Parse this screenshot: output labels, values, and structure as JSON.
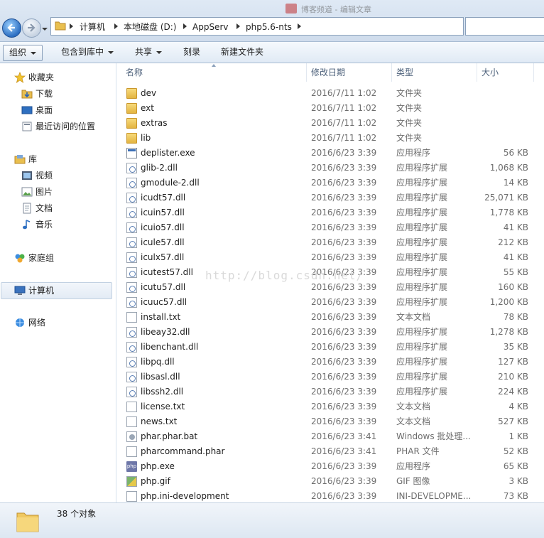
{
  "address": {
    "breadcrumbs": [
      "计算机",
      "本地磁盘 (D:)",
      "AppServ",
      "php5.6-nts"
    ],
    "background_tab_title": "博客频道 - 编辑文章"
  },
  "toolbar": {
    "organize": "组织",
    "include_in_library": "包含到库中",
    "share": "共享",
    "burn": "刻录",
    "new_folder": "新建文件夹"
  },
  "nav": {
    "favorites": "收藏夹",
    "downloads": "下载",
    "desktop": "桌面",
    "recent": "最近访问的位置",
    "libraries": "库",
    "videos": "视频",
    "pictures": "图片",
    "documents": "文档",
    "music": "音乐",
    "homegroup": "家庭组",
    "computer": "计算机",
    "network": "网络"
  },
  "columns": {
    "name": "名称",
    "date": "修改日期",
    "type": "类型",
    "size": "大小"
  },
  "files": [
    {
      "name": "dev",
      "date": "2016/7/11 1:02",
      "type": "文件夹",
      "size": "",
      "icon": "folder"
    },
    {
      "name": "ext",
      "date": "2016/7/11 1:02",
      "type": "文件夹",
      "size": "",
      "icon": "folder"
    },
    {
      "name": "extras",
      "date": "2016/7/11 1:02",
      "type": "文件夹",
      "size": "",
      "icon": "folder"
    },
    {
      "name": "lib",
      "date": "2016/7/11 1:02",
      "type": "文件夹",
      "size": "",
      "icon": "folder"
    },
    {
      "name": "deplister.exe",
      "date": "2016/6/23 3:39",
      "type": "应用程序",
      "size": "56 KB",
      "icon": "exe"
    },
    {
      "name": "glib-2.dll",
      "date": "2016/6/23 3:39",
      "type": "应用程序扩展",
      "size": "1,068 KB",
      "icon": "dll"
    },
    {
      "name": "gmodule-2.dll",
      "date": "2016/6/23 3:39",
      "type": "应用程序扩展",
      "size": "14 KB",
      "icon": "dll"
    },
    {
      "name": "icudt57.dll",
      "date": "2016/6/23 3:39",
      "type": "应用程序扩展",
      "size": "25,071 KB",
      "icon": "dll"
    },
    {
      "name": "icuin57.dll",
      "date": "2016/6/23 3:39",
      "type": "应用程序扩展",
      "size": "1,778 KB",
      "icon": "dll"
    },
    {
      "name": "icuio57.dll",
      "date": "2016/6/23 3:39",
      "type": "应用程序扩展",
      "size": "41 KB",
      "icon": "dll"
    },
    {
      "name": "icule57.dll",
      "date": "2016/6/23 3:39",
      "type": "应用程序扩展",
      "size": "212 KB",
      "icon": "dll"
    },
    {
      "name": "iculx57.dll",
      "date": "2016/6/23 3:39",
      "type": "应用程序扩展",
      "size": "41 KB",
      "icon": "dll"
    },
    {
      "name": "icutest57.dll",
      "date": "2016/6/23 3:39",
      "type": "应用程序扩展",
      "size": "55 KB",
      "icon": "dll"
    },
    {
      "name": "icutu57.dll",
      "date": "2016/6/23 3:39",
      "type": "应用程序扩展",
      "size": "160 KB",
      "icon": "dll"
    },
    {
      "name": "icuuc57.dll",
      "date": "2016/6/23 3:39",
      "type": "应用程序扩展",
      "size": "1,200 KB",
      "icon": "dll"
    },
    {
      "name": "install.txt",
      "date": "2016/6/23 3:39",
      "type": "文本文档",
      "size": "78 KB",
      "icon": "doc"
    },
    {
      "name": "libeay32.dll",
      "date": "2016/6/23 3:39",
      "type": "应用程序扩展",
      "size": "1,278 KB",
      "icon": "dll"
    },
    {
      "name": "libenchant.dll",
      "date": "2016/6/23 3:39",
      "type": "应用程序扩展",
      "size": "35 KB",
      "icon": "dll"
    },
    {
      "name": "libpq.dll",
      "date": "2016/6/23 3:39",
      "type": "应用程序扩展",
      "size": "127 KB",
      "icon": "dll"
    },
    {
      "name": "libsasl.dll",
      "date": "2016/6/23 3:39",
      "type": "应用程序扩展",
      "size": "210 KB",
      "icon": "dll"
    },
    {
      "name": "libssh2.dll",
      "date": "2016/6/23 3:39",
      "type": "应用程序扩展",
      "size": "224 KB",
      "icon": "dll"
    },
    {
      "name": "license.txt",
      "date": "2016/6/23 3:39",
      "type": "文本文档",
      "size": "4 KB",
      "icon": "doc"
    },
    {
      "name": "news.txt",
      "date": "2016/6/23 3:39",
      "type": "文本文档",
      "size": "527 KB",
      "icon": "doc"
    },
    {
      "name": "phar.phar.bat",
      "date": "2016/6/23 3:41",
      "type": "Windows 批处理...",
      "size": "1 KB",
      "icon": "bat"
    },
    {
      "name": "pharcommand.phar",
      "date": "2016/6/23 3:41",
      "type": "PHAR 文件",
      "size": "52 KB",
      "icon": "doc"
    },
    {
      "name": "php.exe",
      "date": "2016/6/23 3:39",
      "type": "应用程序",
      "size": "65 KB",
      "icon": "php"
    },
    {
      "name": "php.gif",
      "date": "2016/6/23 3:39",
      "type": "GIF 图像",
      "size": "3 KB",
      "icon": "gif"
    },
    {
      "name": "php.ini-development",
      "date": "2016/6/23 3:39",
      "type": "INI-DEVELOPME...",
      "size": "73 KB",
      "icon": "doc"
    }
  ],
  "watermark": "http://blog.csdn.net/",
  "status": {
    "item_count": "38 个对象"
  }
}
